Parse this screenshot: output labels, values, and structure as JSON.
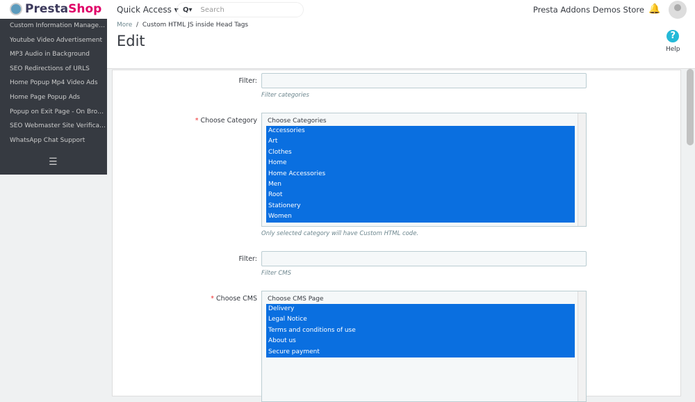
{
  "header": {
    "logo": {
      "prefix": "Presta",
      "suffix": "Shop"
    },
    "quick_access": "Quick Access ▾",
    "search_placeholder": "Search",
    "store_name": "Presta Addons Demos Store"
  },
  "sidebar": {
    "items": [
      "Custom Information Management",
      "Youtube Video Advertisement",
      "MP3 Audio in Background",
      "SEO Redirections of URLS",
      "Home Popup Mp4 Video Ads",
      "Home Page Popup Ads",
      "Popup on Exit Page - On Browser Close",
      "SEO Webmaster Site Verification",
      "WhatsApp Chat Support"
    ]
  },
  "breadcrumb": {
    "parent": "More",
    "separator": "/",
    "current": "Custom HTML JS inside Head Tags"
  },
  "page_title": "Edit",
  "help": "Help",
  "form": {
    "category_filter": {
      "label": "Filter:",
      "hint": "Filter categories"
    },
    "category": {
      "label": "Choose Category",
      "header": "Choose Categories",
      "options": [
        "Accessories",
        "Art",
        "Clothes",
        "Home",
        "Home Accessories",
        "Men",
        "Root",
        "Stationery",
        "Women"
      ],
      "hint": "Only selected category will have Custom HTML code."
    },
    "cms_filter": {
      "label": "Filter:",
      "hint": "Filter CMS"
    },
    "cms": {
      "label": "Choose CMS",
      "header": "Choose CMS Page",
      "options": [
        "Delivery",
        "Legal Notice",
        "Terms and conditions of use",
        "About us",
        "Secure payment"
      ]
    }
  }
}
